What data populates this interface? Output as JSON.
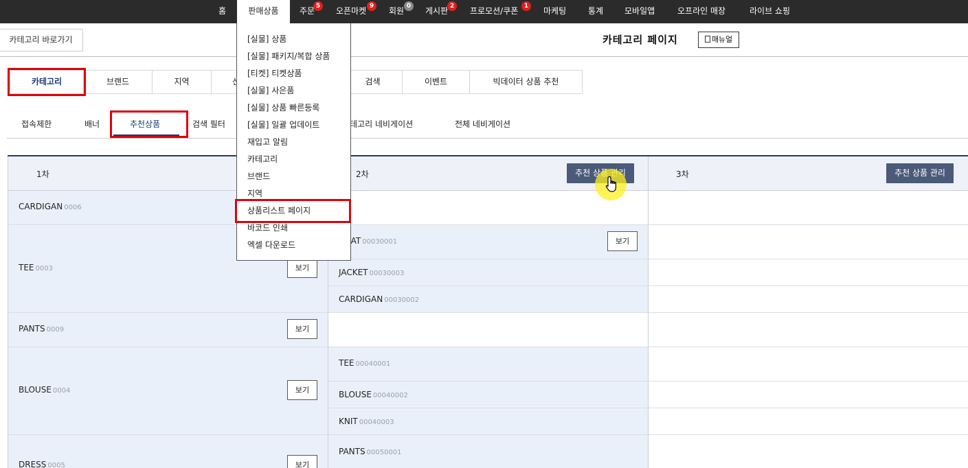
{
  "nav": {
    "items": [
      {
        "label": "홈"
      },
      {
        "label": "판매상품"
      },
      {
        "label": "주문",
        "badge": "5"
      },
      {
        "label": "오픈마켓",
        "badge": "9"
      },
      {
        "label": "회원",
        "badge": "0"
      },
      {
        "label": "게시판",
        "badge": "2"
      },
      {
        "label": "프로모션/쿠폰",
        "badge": "1"
      },
      {
        "label": "마케팅"
      },
      {
        "label": "통계"
      },
      {
        "label": "모바일앱"
      },
      {
        "label": "오프라인 매장"
      },
      {
        "label": "라이브 쇼핑"
      }
    ]
  },
  "header": {
    "shortcut": "카테고리 바로가기",
    "title": "카테고리 페이지",
    "manual": "매뉴얼"
  },
  "tabs": [
    {
      "label": "카테고리"
    },
    {
      "label": "브랜드"
    },
    {
      "label": "지역"
    },
    {
      "label": "신"
    },
    {
      "label": "검색"
    },
    {
      "label": "이벤트"
    },
    {
      "label": "빅데이터 상품 추천"
    }
  ],
  "subtabs": [
    {
      "label": "접속제한"
    },
    {
      "label": "배너"
    },
    {
      "label": "추천상품"
    },
    {
      "label": "검색 필터"
    },
    {
      "label": "카테고리 네비게이션"
    },
    {
      "label": "전체 네비게이션"
    }
  ],
  "grid": {
    "col1_title": "1차",
    "col2_title": "2차",
    "col3_title": "3차",
    "manage_label": "추천 상품 관리",
    "view_label": "보기",
    "level1": [
      {
        "name": "CARDIGAN",
        "code": "0006"
      },
      {
        "name": "TEE",
        "code": "0003"
      },
      {
        "name": "PANTS",
        "code": "0009"
      },
      {
        "name": "BLOUSE",
        "code": "0004"
      },
      {
        "name": "DRESS",
        "code": "0005"
      }
    ],
    "level2": [
      {
        "name": "COAT",
        "code": "00030001"
      },
      {
        "name": "JACKET",
        "code": "00030003"
      },
      {
        "name": "CARDIGAN",
        "code": "00030002"
      },
      {
        "name": "TEE",
        "code": "00040001"
      },
      {
        "name": "BLOUSE",
        "code": "00040002"
      },
      {
        "name": "KNIT",
        "code": "00040003"
      },
      {
        "name": "PANTS",
        "code": "00050001"
      }
    ]
  },
  "dropdown": {
    "items": [
      "[실물] 상품",
      "[실물] 패키지/복합 상품",
      "[티켓] 티켓상품",
      "[실물] 사은품",
      "[실물] 상품 빠른등록",
      "[실물] 일괄 업데이트",
      "재입고 알림",
      "카테고리",
      "브랜드",
      "지역",
      "상품리스트 페이지",
      "바코드 인쇄",
      "엑셀 다운로드"
    ]
  },
  "colors": {
    "nav_bg": "#2b2b2b",
    "badge": "#e0201e",
    "highlight": "#e0000a",
    "manage_btn": "#4a5a78",
    "accent": "#1a3b7a"
  }
}
